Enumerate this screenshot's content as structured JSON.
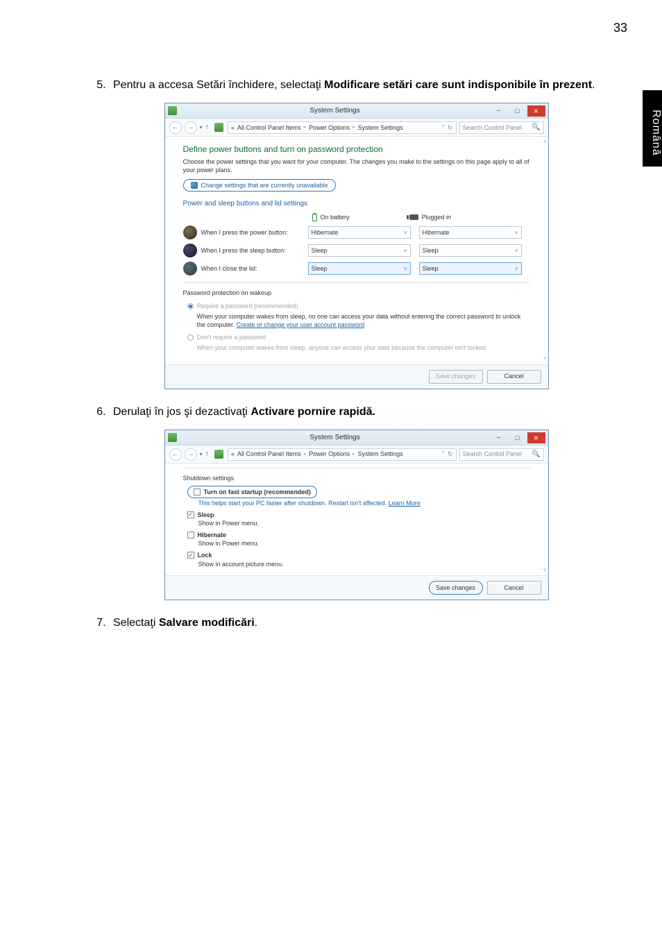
{
  "page_number": "33",
  "side_tab": "Română",
  "step5": {
    "prefix": "Pentru a accesa Setări închidere, selectaţi ",
    "bold": "Modificare setări care sunt indisponibile în prezent",
    "suffix": "."
  },
  "step6": {
    "prefix": "Derulaţi în jos şi dezactivaţi ",
    "bold": "Activare pornire rapidă.",
    "suffix": ""
  },
  "step7": {
    "prefix": "Selectaţi ",
    "bold": "Salvare modificări",
    "suffix": "."
  },
  "win1": {
    "title": "System Settings",
    "breadcrumb": {
      "prefix": "«",
      "p1": "All Control Panel Items",
      "p2": "Power Options",
      "p3": "System Settings"
    },
    "search_placeholder": "Search Control Panel",
    "heading": "Define power buttons and turn on password protection",
    "desc": "Choose the power settings that you want for your computer. The changes you make to the settings on this page apply to all of your power plans.",
    "change_link": "Change settings that are currently unavailable",
    "section": "Power and sleep buttons and lid settings",
    "col_battery": "On battery",
    "col_plugged": "Plugged in",
    "rows": [
      {
        "label": "When I press the power button:",
        "v1": "Hibernate",
        "v2": "Hibernate"
      },
      {
        "label": "When I press the sleep button:",
        "v1": "Sleep",
        "v2": "Sleep"
      },
      {
        "label": "When I close the lid:",
        "v1": "Sleep",
        "v2": "Sleep"
      }
    ],
    "fieldset": "Password protection on wakeup",
    "opt1_label": "Require a password (recommended)",
    "opt1_desc_a": "When your computer wakes from sleep, no one can access your data without entering the correct password to unlock the computer. ",
    "opt1_link": "Create or change your user account password",
    "opt2_label": "Don't require a password",
    "opt2_desc": "When your computer wakes from sleep, anyone can access your data because the computer isn't locked.",
    "save": "Save changes",
    "cancel": "Cancel"
  },
  "win2": {
    "title": "System Settings",
    "breadcrumb": {
      "prefix": "«",
      "p1": "All Control Panel Items",
      "p2": "Power Options",
      "p3": "System Settings"
    },
    "search_placeholder": "Search Control Panel",
    "fieldset": "Shutdown settings",
    "fast_label": "Turn on fast startup (recommended)",
    "fast_desc_a": "This helps start your PC faster after shutdown. Restart isn't affected. ",
    "fast_link": "Learn More",
    "sleep": "Sleep",
    "sleep_desc": "Show in Power menu.",
    "hibernate": "Hibernate",
    "hibernate_desc": "Show in Power menu.",
    "lock": "Lock",
    "lock_desc": "Show in account picture menu.",
    "save": "Save changes",
    "cancel": "Cancel"
  }
}
